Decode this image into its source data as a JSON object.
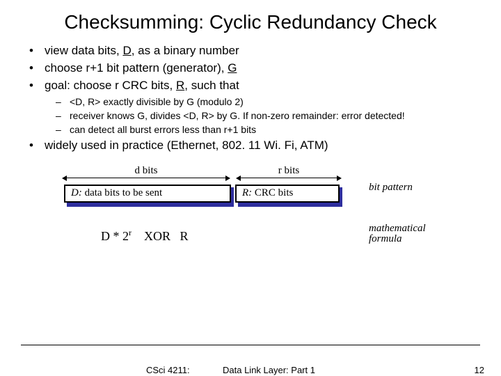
{
  "title": "Checksumming: Cyclic Redundancy Check",
  "bullets": {
    "b1a": "view data bits, ",
    "b1b": "D",
    "b1c": ", as a binary number",
    "b2a": "choose r+1 bit pattern (generator), ",
    "b2b": "G",
    "b3a": "goal: choose r CRC bits, ",
    "b3b": "R",
    "b3c": ", such that",
    "s1": "<D, R> exactly divisible by G (modulo 2)",
    "s2": "receiver knows G, divides <D, R> by G.  If non-zero remainder: error detected!",
    "s3": "can detect all burst errors less than r+1 bits",
    "b4": "widely used in practice (Ethernet, 802. 11 Wi. Fi, ATM)"
  },
  "diagram": {
    "dbits": "d bits",
    "rbits": "r bits",
    "dbox_a": "D:",
    "dbox_b": " data bits to be sent",
    "rbox_a": "R:",
    "rbox_b": " CRC bits",
    "bit_pattern": "bit pattern",
    "math_formula_label": "mathematical formula",
    "math": "D * 2     XOR   R",
    "math_sup": "r"
  },
  "footer": {
    "course": "CSci 4211:",
    "topic": "Data Link Layer: Part 1",
    "page": "12"
  }
}
